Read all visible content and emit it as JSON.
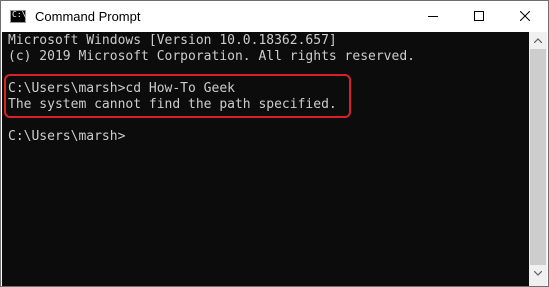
{
  "window": {
    "title": "Command Prompt",
    "icon": "command-prompt-icon",
    "icon_glyph": "C:\\",
    "controls": [
      "minimize-icon",
      "maximize-icon",
      "close-icon"
    ]
  },
  "console": {
    "lines": [
      "Microsoft Windows [Version 10.0.18362.657]",
      "(c) 2019 Microsoft Corporation. All rights reserved.",
      "C:\\Users\\marsh>cd How-To Geek",
      "The system cannot find the path specified.",
      "C:\\Users\\marsh>"
    ],
    "background_color": "#0c0c0c",
    "text_color": "#cccccc",
    "highlight_color": "#d72027"
  },
  "scrollbar": {
    "up_icon": "scroll-up-arrow-icon",
    "down_icon": "scroll-down-arrow-icon"
  }
}
